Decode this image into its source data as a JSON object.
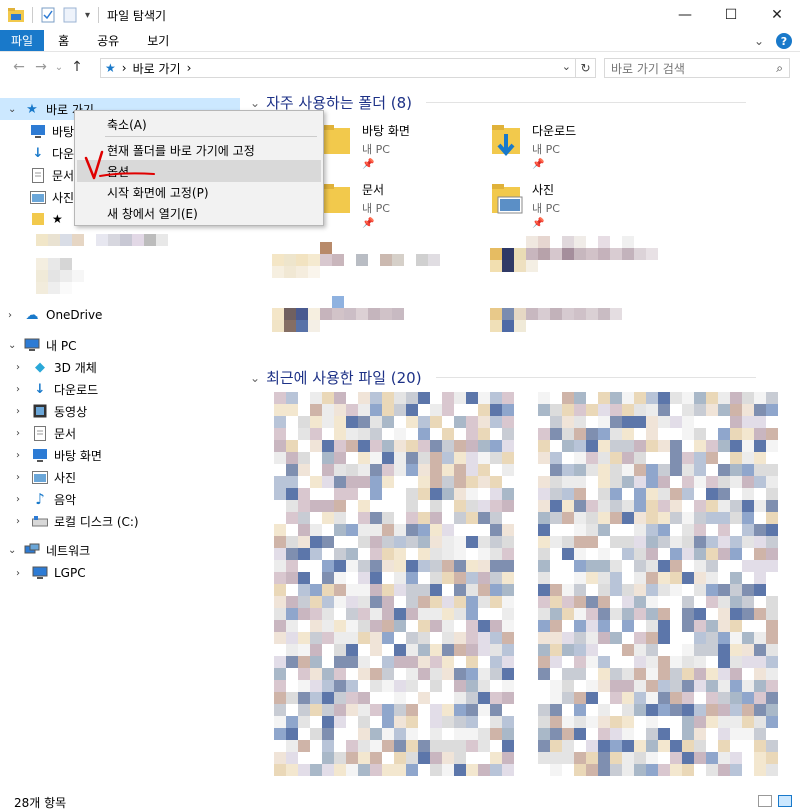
{
  "window": {
    "title": "파일 탐색기",
    "minimize": "—",
    "maximize": "☐",
    "close": "✕"
  },
  "ribbon": {
    "tabs": [
      "파일",
      "홈",
      "공유",
      "보기"
    ],
    "collapse": "⌄",
    "help": "?"
  },
  "nav": {
    "back": "←",
    "forward": "→",
    "recent": "⌄",
    "up": "↑"
  },
  "address": {
    "star": "★",
    "sep1": "›",
    "crumb": "바로 가기",
    "sep2": "›",
    "dropdown": "⌄",
    "refresh": "↻"
  },
  "search": {
    "placeholder": "바로 가기 검색",
    "icon": "⌕"
  },
  "navpane": {
    "quick_access": "바로 가기",
    "qa_items": [
      "바탕",
      "다운로",
      "문서",
      "사진",
      "★"
    ],
    "onedrive": "OneDrive",
    "this_pc": "내 PC",
    "pc_items": [
      "3D 개체",
      "다운로드",
      "동영상",
      "문서",
      "바탕 화면",
      "사진",
      "음악",
      "로컬 디스크 (C:)"
    ],
    "network": "네트워크",
    "network_items": [
      "LGPC"
    ]
  },
  "content": {
    "frequent_header": "자주 사용하는 폴더 (8)",
    "recent_header": "최근에 사용한 파일 (20)",
    "folders": [
      {
        "name": "바탕 화면",
        "sub": "내 PC",
        "pin": "📌"
      },
      {
        "name": "다운로드",
        "sub": "내 PC",
        "pin": "📌"
      },
      {
        "name": "문서",
        "sub": "내 PC",
        "pin": "📌"
      },
      {
        "name": "사진",
        "sub": "내 PC",
        "pin": "📌"
      }
    ]
  },
  "context_menu": {
    "items": [
      "축소(A)",
      "현재 폴더를 바로 가기에 고정",
      "옵션",
      "시작 화면에 고정(P)",
      "새 창에서 열기(E)"
    ]
  },
  "status": {
    "count": "28개 항목"
  },
  "colors": {
    "accent": "#1979ca",
    "selection": "#cce8ff",
    "section_header": "#1e3287",
    "annotation": "#e00000"
  }
}
